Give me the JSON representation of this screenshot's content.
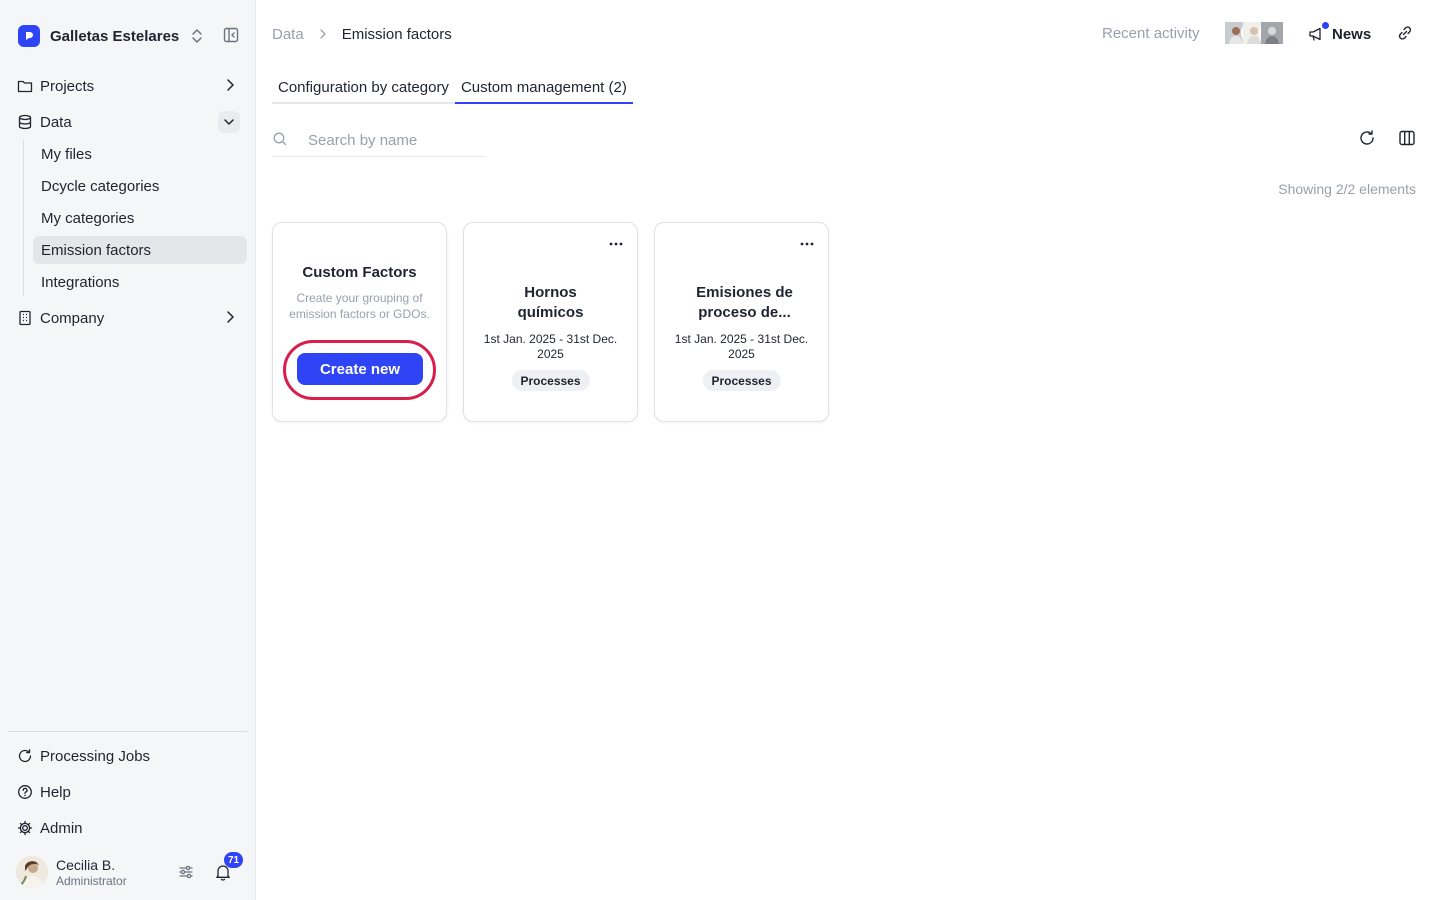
{
  "sidebar": {
    "org_name": "Galletas Estelares",
    "nav": {
      "projects": "Projects",
      "data": "Data",
      "company": "Company"
    },
    "data_children": [
      "My files",
      "Dcycle categories",
      "My categories",
      "Emission factors",
      "Integrations"
    ],
    "bottom": {
      "processing_jobs": "Processing Jobs",
      "help": "Help",
      "admin": "Admin"
    },
    "user": {
      "name": "Cecilia B.",
      "role": "Administrator",
      "notifications": "71"
    }
  },
  "header": {
    "breadcrumb_root": "Data",
    "breadcrumb_current": "Emission factors",
    "recent_activity": "Recent activity",
    "news": "News"
  },
  "tabs": [
    "Configuration by category",
    "Custom management (2)"
  ],
  "active_tab": 1,
  "search": {
    "placeholder": "Search by name",
    "value": ""
  },
  "showing": "Showing 2/2 elements",
  "create_card": {
    "title": "Custom Factors",
    "description": "Create your grouping of emission factors or GDOs.",
    "button": "Create new"
  },
  "cards": [
    {
      "title": "Hornos químicos",
      "dates": "1st Jan. 2025 - 31st Dec. 2025",
      "tag": "Processes"
    },
    {
      "title": "Emisiones de proceso de...",
      "dates": "1st Jan. 2025 - 31st Dec. 2025",
      "tag": "Processes"
    }
  ],
  "colors": {
    "accent": "#2e44f5",
    "highlight_ring": "#d81e4b"
  }
}
